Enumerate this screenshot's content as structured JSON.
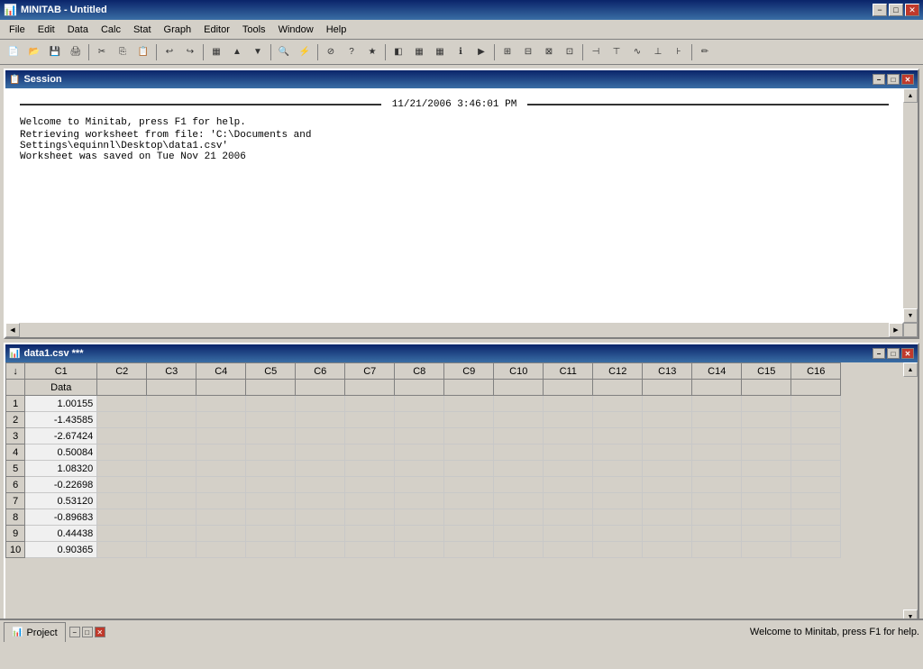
{
  "titleBar": {
    "title": "MINITAB - Untitled",
    "minimizeLabel": "−",
    "maximizeLabel": "□",
    "closeLabel": "✕"
  },
  "menuBar": {
    "items": [
      {
        "label": "File",
        "key": "file"
      },
      {
        "label": "Edit",
        "key": "edit"
      },
      {
        "label": "Data",
        "key": "data"
      },
      {
        "label": "Calc",
        "key": "calc"
      },
      {
        "label": "Stat",
        "key": "stat"
      },
      {
        "label": "Graph",
        "key": "graph"
      },
      {
        "label": "Editor",
        "key": "editor"
      },
      {
        "label": "Tools",
        "key": "tools"
      },
      {
        "label": "Window",
        "key": "window"
      },
      {
        "label": "Help",
        "key": "help"
      }
    ]
  },
  "toolbar": {
    "buttons": [
      {
        "label": "📄",
        "name": "new-btn",
        "title": "New"
      },
      {
        "label": "📂",
        "name": "open-btn",
        "title": "Open"
      },
      {
        "label": "💾",
        "name": "save-btn",
        "title": "Save"
      },
      {
        "label": "🖨",
        "name": "print-btn",
        "title": "Print"
      },
      {
        "sep": true
      },
      {
        "label": "✂",
        "name": "cut-btn",
        "title": "Cut"
      },
      {
        "label": "📋",
        "name": "copy-btn",
        "title": "Copy"
      },
      {
        "label": "📌",
        "name": "paste-btn",
        "title": "Paste"
      },
      {
        "sep": true
      },
      {
        "label": "↩",
        "name": "undo-btn",
        "title": "Undo"
      },
      {
        "label": "↪",
        "name": "redo-btn",
        "title": "Redo"
      },
      {
        "sep": true
      },
      {
        "label": "▦",
        "name": "grid1-btn"
      },
      {
        "label": "↑",
        "name": "up-btn"
      },
      {
        "label": "↓",
        "name": "down-btn"
      },
      {
        "sep": true
      },
      {
        "label": "🔍",
        "name": "find-btn"
      },
      {
        "label": "⚡",
        "name": "run-btn"
      },
      {
        "sep": true
      },
      {
        "label": "⊘",
        "name": "stop-btn"
      },
      {
        "label": "?",
        "name": "help-btn"
      },
      {
        "label": "★",
        "name": "fav-btn"
      },
      {
        "sep": true
      },
      {
        "label": "◧",
        "name": "sess-btn"
      },
      {
        "label": "▦",
        "name": "ws-btn"
      },
      {
        "label": "▦",
        "name": "hist-btn"
      },
      {
        "label": "ℹ",
        "name": "info-btn"
      },
      {
        "label": "▶",
        "name": "play-btn"
      },
      {
        "sep": true
      },
      {
        "label": "⊞",
        "name": "grid2-btn"
      },
      {
        "label": "⊟",
        "name": "grid3-btn"
      },
      {
        "label": "⊠",
        "name": "grid4-btn"
      },
      {
        "label": "⊡",
        "name": "grid5-btn"
      },
      {
        "label": "⊢",
        "name": "grid6-btn"
      },
      {
        "sep": true
      },
      {
        "label": "⊣",
        "name": "stat1-btn"
      },
      {
        "label": "⊤",
        "name": "stat2-btn"
      },
      {
        "label": "∿",
        "name": "chart-btn"
      },
      {
        "label": "⊥",
        "name": "stat3-btn"
      },
      {
        "label": "⊦",
        "name": "stat4-btn"
      },
      {
        "sep": true
      },
      {
        "label": "✏",
        "name": "draw-btn"
      }
    ]
  },
  "sessionWindow": {
    "title": "Session",
    "timestamp": "11/21/2006 3:46:01 PM",
    "messages": [
      "Welcome to Minitab, press F1 for help.",
      "Retrieving worksheet from file: 'C:\\Documents and",
      "Settings\\equinnl\\Desktop\\data1.csv'",
      "Worksheet was saved on Tue Nov 21 2006"
    ]
  },
  "worksheetWindow": {
    "title": "data1.csv ***",
    "columns": [
      {
        "label": "C1",
        "key": "c1"
      },
      {
        "label": "C2",
        "key": "c2"
      },
      {
        "label": "C3",
        "key": "c3"
      },
      {
        "label": "C4",
        "key": "c4"
      },
      {
        "label": "C5",
        "key": "c5"
      },
      {
        "label": "C6",
        "key": "c6"
      },
      {
        "label": "C7",
        "key": "c7"
      },
      {
        "label": "C8",
        "key": "c8"
      },
      {
        "label": "C9",
        "key": "c9"
      },
      {
        "label": "C10",
        "key": "c10"
      },
      {
        "label": "C11",
        "key": "c11"
      },
      {
        "label": "C12",
        "key": "c12"
      },
      {
        "label": "C13",
        "key": "c13"
      },
      {
        "label": "C14",
        "key": "c14"
      },
      {
        "label": "C15",
        "key": "c15"
      },
      {
        "label": "C16",
        "key": "c16"
      }
    ],
    "c1Header": "Data",
    "rows": [
      {
        "num": "1",
        "c1": "1.00155"
      },
      {
        "num": "2",
        "c1": "-1.43585"
      },
      {
        "num": "3",
        "c1": "-2.67424"
      },
      {
        "num": "4",
        "c1": "0.50084"
      },
      {
        "num": "5",
        "c1": "1.08320"
      },
      {
        "num": "6",
        "c1": "-0.22698"
      },
      {
        "num": "7",
        "c1": "0.53120"
      },
      {
        "num": "8",
        "c1": "-0.89683"
      },
      {
        "num": "9",
        "c1": "0.44438"
      },
      {
        "num": "10",
        "c1": "0.90365"
      }
    ]
  },
  "projectBar": {
    "label": "Project",
    "btnMin": "−",
    "btnMax": "□",
    "btnClose": "✕"
  },
  "statusBar": {
    "text": "Welcome to Minitab, press F1 for help."
  }
}
